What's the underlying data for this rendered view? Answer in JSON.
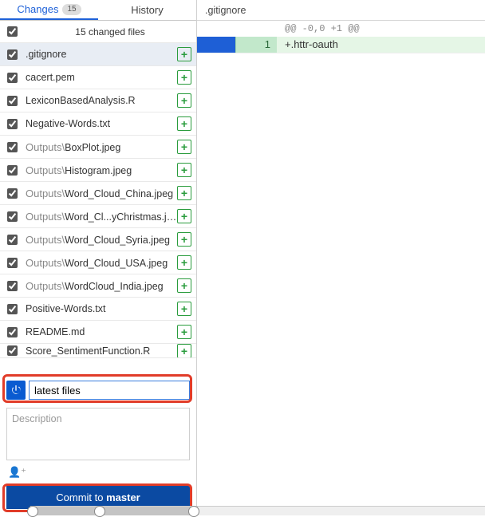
{
  "tabs": {
    "changes": {
      "label": "Changes",
      "badge": "15"
    },
    "history": {
      "label": "History"
    }
  },
  "changesHeader": "15 changed files",
  "files": [
    {
      "dir": "",
      "name": ".gitignore",
      "selected": true
    },
    {
      "dir": "",
      "name": "cacert.pem"
    },
    {
      "dir": "",
      "name": "LexiconBasedAnalysis.R"
    },
    {
      "dir": "",
      "name": "Negative-Words.txt"
    },
    {
      "dir": "Outputs\\",
      "name": "BoxPlot.jpeg"
    },
    {
      "dir": "Outputs\\",
      "name": "Histogram.jpeg"
    },
    {
      "dir": "Outputs\\",
      "name": "Word_Cloud_China.jpeg"
    },
    {
      "dir": "Outputs\\",
      "name": "Word_Cl...yChristmas.jpeg"
    },
    {
      "dir": "Outputs\\",
      "name": "Word_Cloud_Syria.jpeg"
    },
    {
      "dir": "Outputs\\",
      "name": "Word_Cloud_USA.jpeg"
    },
    {
      "dir": "Outputs\\",
      "name": "WordCloud_India.jpeg"
    },
    {
      "dir": "",
      "name": "Positive-Words.txt"
    },
    {
      "dir": "",
      "name": "README.md"
    },
    {
      "dir": "",
      "name": "Score_SentimentFunction.R",
      "cut": true
    }
  ],
  "commit": {
    "summaryValue": "latest files",
    "descPlaceholder": "Description",
    "coauthorIcon": "👤⁺",
    "buttonPrefix": "Commit to ",
    "buttonBranch": "master"
  },
  "diff": {
    "filename": ".gitignore",
    "hunkHeader": "@@ -0,0 +1 @@",
    "lineNo": "1",
    "lineText": "+.httr-oauth"
  }
}
